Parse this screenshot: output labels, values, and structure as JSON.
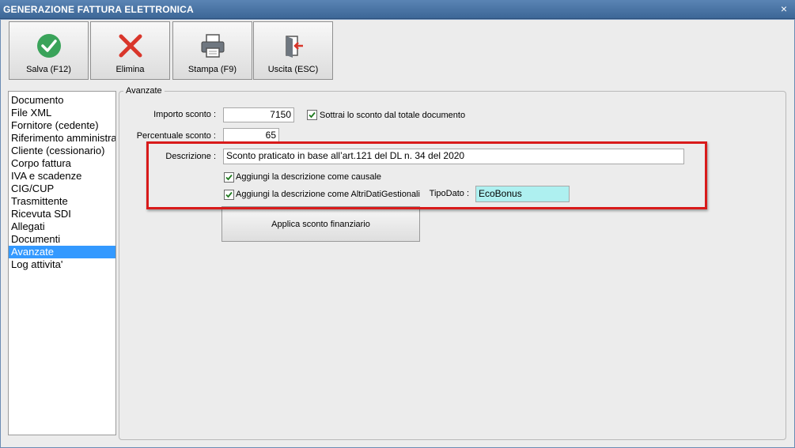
{
  "window": {
    "title": "GENERAZIONE FATTURA ELETTRONICA",
    "close_glyph": "×"
  },
  "toolbar": {
    "save": {
      "label": "Salva (F12)",
      "icon": "check-circle-icon",
      "color": "#3aa35a"
    },
    "delete": {
      "label": "Elimina",
      "icon": "x-icon",
      "color": "#d9362b"
    },
    "print": {
      "label": "Stampa (F9)",
      "icon": "printer-icon"
    },
    "exit": {
      "label": "Uscita (ESC)",
      "icon": "exit-door-icon",
      "color": "#d9362b"
    }
  },
  "sidebar": {
    "items": [
      {
        "label": "Documento"
      },
      {
        "label": "File XML"
      },
      {
        "label": "Fornitore (cedente)"
      },
      {
        "label": "Riferimento amministrativo"
      },
      {
        "label": "Cliente (cessionario)"
      },
      {
        "label": "Corpo fattura"
      },
      {
        "label": "IVA e scadenze"
      },
      {
        "label": "CIG/CUP"
      },
      {
        "label": "Trasmittente"
      },
      {
        "label": "Ricevuta SDI"
      },
      {
        "label": "Allegati"
      },
      {
        "label": "Documenti"
      },
      {
        "label": "Avanzate",
        "selected": true
      },
      {
        "label": "Log attivita'"
      }
    ]
  },
  "panel": {
    "title": "Avanzate",
    "importo_label": "Importo sconto :",
    "importo_value": "7150",
    "sottrai_label": "Sottrai lo sconto dal totale documento",
    "sottrai_checked": true,
    "percentuale_label": "Percentuale sconto :",
    "percentuale_value": "65",
    "descrizione_label": "Descrizione :",
    "descrizione_value": "Sconto praticato in base all’art.121 del DL n. 34 del 2020",
    "causale_label": "Aggiungi la descrizione come causale",
    "causale_checked": true,
    "altri_label": "Aggiungi la descrizione come AltriDatiGestionali",
    "altri_checked": true,
    "tipodato_label": "TipoDato :",
    "tipodato_value": "EcoBonus",
    "apply_button": "Applica sconto finanziario"
  },
  "colors": {
    "highlight": "#d81a1a",
    "selection": "#3399ff",
    "tipodato_bg": "#aef0f0",
    "titlebar": "#4a75a6"
  }
}
